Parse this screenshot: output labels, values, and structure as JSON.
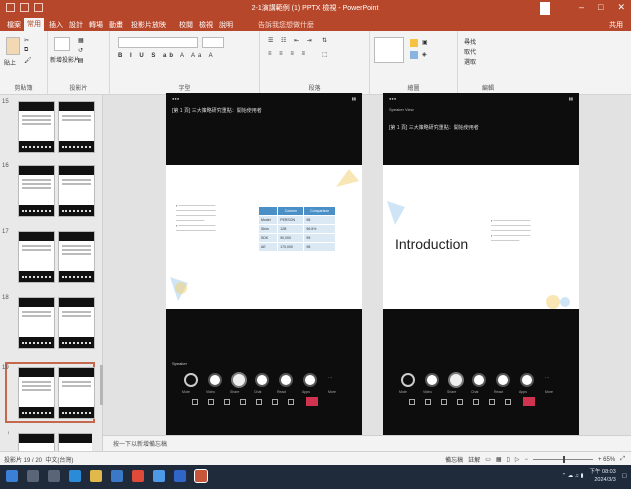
{
  "window": {
    "title": "2-1演講範例 (1) PPTX 檢視 - PowerPoint"
  },
  "tabs": [
    "檔案",
    "常用",
    "插入",
    "設計",
    "轉場",
    "動畫",
    "投影片放映",
    "校閱",
    "檢視",
    "說明"
  ],
  "tell_me": "告訴我您想做什麼",
  "share": "共用",
  "ribbon": {
    "groups": [
      "剪貼簿",
      "投影片",
      "字型",
      "段落",
      "繪圖",
      "編輯"
    ],
    "paste": "貼上",
    "new_slide": "新增投影片",
    "find": "尋找",
    "replace": "取代",
    "select": "選取"
  },
  "slide_numbers": [
    "15",
    "16",
    "17",
    "18",
    "19",
    "20"
  ],
  "slides": [
    {
      "caption": "[第 1 頁] 三大策略研究重點：開始使用者",
      "table": {
        "headers": [
          "",
          "Column",
          "Comparison"
        ],
        "rows": [
          [
            "Model",
            "PERSON",
            "98"
          ],
          [
            "Skim",
            "12B",
            "96.5%"
          ],
          [
            "SDK",
            "90,000",
            "95"
          ],
          [
            "AE",
            "170,000",
            "98"
          ]
        ]
      },
      "speaker": "Speaker",
      "controls": [
        "Mute",
        "Video",
        "Share",
        "Chat",
        "React",
        "Apps",
        "More"
      ]
    },
    {
      "caption": "[第 1 頁] 三大策略研究重點：開始使用者",
      "heading": "Introduction",
      "sub_caption": "Speaker View",
      "controls": [
        "Mute",
        "Video",
        "Share",
        "Chat",
        "React",
        "Apps",
        "More"
      ]
    }
  ],
  "notes_placeholder": "按一下以新增備忘稿",
  "status": {
    "slide": "投影片 19 / 20",
    "language": "中文(台灣)",
    "notes": "備忘稿",
    "comments": "註解",
    "zoom": "+ 65%"
  },
  "taskbar": {
    "time": "下午 08:03",
    "date": "2024/3/3"
  },
  "colors": {
    "accent": "#b7472a",
    "table_header": "#4a90c7",
    "end_call": "#d0334f"
  }
}
